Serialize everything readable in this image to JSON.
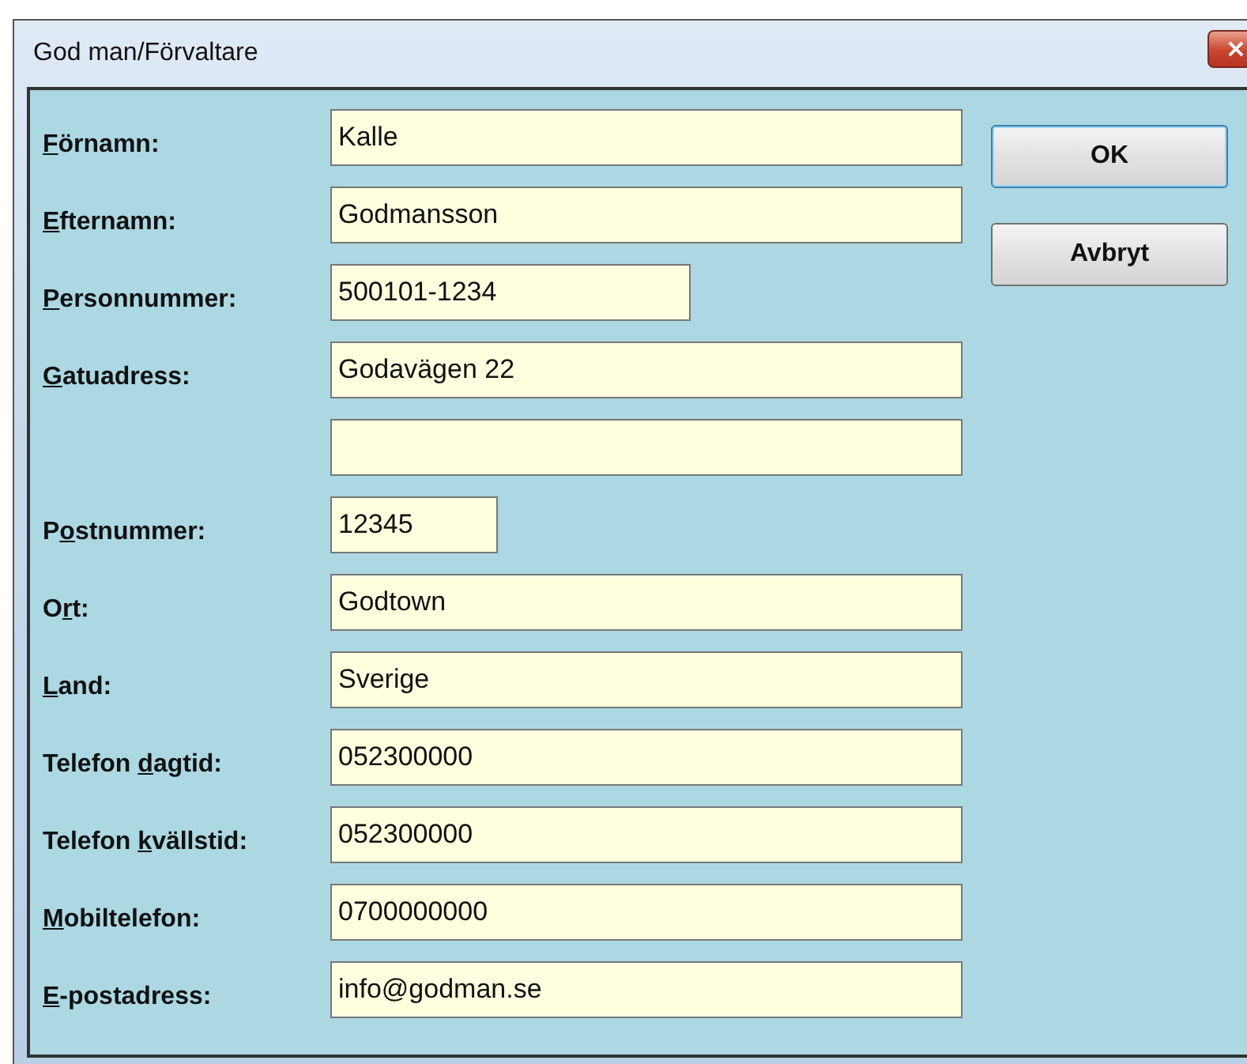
{
  "window": {
    "title": "God man/Förvaltare",
    "close_glyph": "×"
  },
  "fields": [
    {
      "label": {
        "key": "F",
        "post": "örnamn:"
      },
      "value": "Kalle",
      "kind": "long"
    },
    {
      "label": {
        "key": "E",
        "post": "fternamn:"
      },
      "value": "Godmansson",
      "kind": "long"
    },
    {
      "label": {
        "key": "P",
        "post": "ersonnummer:"
      },
      "value": "500101-1234",
      "kind": "medium"
    },
    {
      "label": {
        "key": "G",
        "post": "atuadress:"
      },
      "value": "Godavägen 22",
      "kind": "long"
    },
    {
      "kind": "long"
    },
    {
      "label": {
        "pre": "P",
        "key": "o",
        "post": "stnummer:"
      },
      "value": "12345",
      "kind": "short"
    },
    {
      "label": {
        "pre": "O",
        "key": "r",
        "post": "t:"
      },
      "value": "Godtown",
      "kind": "long"
    },
    {
      "label": {
        "key": "L",
        "post": "and:"
      },
      "value": "Sverige",
      "kind": "long"
    },
    {
      "label": {
        "pre": "Telefon ",
        "key": "d",
        "post": "agtid:"
      },
      "value": "052300000",
      "kind": "long"
    },
    {
      "label": {
        "pre": "Telefon ",
        "key": "k",
        "post": "vällstid:"
      },
      "value": "052300000",
      "kind": "long"
    },
    {
      "label": {
        "key": "M",
        "post": "obiltelefon:"
      },
      "value": "0700000000",
      "kind": "long"
    },
    {
      "label": {
        "key": "E",
        "post": "-postadress:"
      },
      "value": "info@godman.se",
      "kind": "long"
    }
  ],
  "buttons": [
    {
      "label": "OK",
      "default": true
    },
    {
      "label": "Avbryt",
      "default": false
    }
  ]
}
